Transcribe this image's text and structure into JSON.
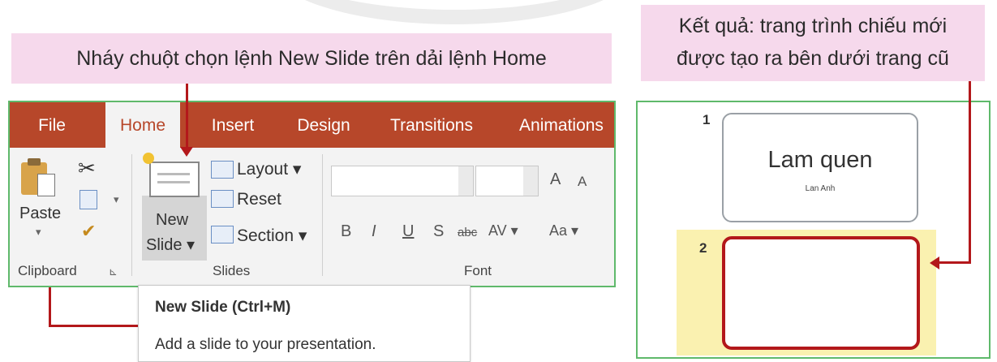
{
  "callouts": {
    "left": "Nháy chuột chọn lệnh New Slide trên dải lệnh Home",
    "right_line1": "Kết quả: trang trình chiếu mới",
    "right_line2": "được tạo ra bên dưới trang cũ"
  },
  "ribbon": {
    "tabs": [
      "File",
      "Home",
      "Insert",
      "Design",
      "Transitions",
      "Animations"
    ],
    "active_tab": "Home",
    "clipboard": {
      "paste_label": "Paste",
      "group_label": "Clipboard"
    },
    "slides": {
      "new_label_line1": "New",
      "new_label_line2": "Slide ▾",
      "layout_label": "Layout ▾",
      "reset_label": "Reset",
      "section_label": "Section ▾",
      "group_label": "Slides"
    },
    "font": {
      "grow_label": "A",
      "shrink_label": "A",
      "buttons": [
        "B",
        "I",
        "U",
        "S",
        "abc",
        "AV ▾",
        "Aa ▾"
      ],
      "group_label": "Font"
    }
  },
  "tooltip": {
    "title": "New Slide (Ctrl+M)",
    "description": "Add a slide to your presentation."
  },
  "slides_pane": {
    "slides": [
      {
        "number": "1",
        "title": "Lam quen",
        "subtitle": "Lan Anh"
      },
      {
        "number": "2",
        "title": "",
        "subtitle": ""
      }
    ]
  },
  "colors": {
    "accent_red": "#b3181b",
    "tab_bar": "#b7472a",
    "callout_pink": "#f6d9ec",
    "panel_border_green": "#5fb96b",
    "selected_slide_bg": "#faf1b0"
  }
}
